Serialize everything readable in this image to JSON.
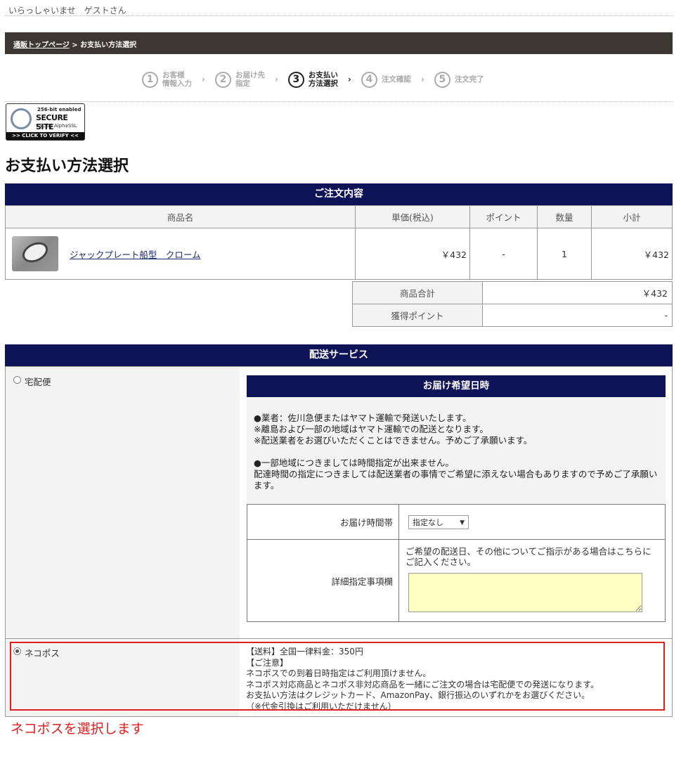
{
  "header": {
    "greeting": "いらっしゃいませ　ゲストさん"
  },
  "breadcrumb": {
    "home": "通販トップページ",
    "sep": " > ",
    "current": "お支払い方法選択"
  },
  "steps": [
    {
      "num": "1",
      "label": "お客様\n情報入力"
    },
    {
      "num": "2",
      "label": "お届け先\n指定"
    },
    {
      "num": "3",
      "label": "お支払い\n方法選択"
    },
    {
      "num": "4",
      "label": "注文確認"
    },
    {
      "num": "5",
      "label": "注文完了"
    }
  ],
  "arrow": "›",
  "ssl": {
    "line1": "256-bit enabled",
    "line2": "SECURE SITE",
    "line3": "SSL by AlphaSSL",
    "verify": ">> CLICK TO VERIFY <<"
  },
  "page_title": "お支払い方法選択",
  "order": {
    "title": "ご注文内容",
    "columns": [
      "商品名",
      "単価(税込)",
      "ポイント",
      "数量",
      "小計"
    ],
    "item": {
      "name": "ジャックプレート船型　クローム",
      "price": "￥432",
      "points": "-",
      "qty": "1",
      "subtotal": "￥432"
    },
    "total_label": "商品合計",
    "total_value": "￥432",
    "points_label": "獲得ポイント",
    "points_value": "-"
  },
  "shipping": {
    "title": "配送サービス",
    "opt1_label": "宅配便",
    "delivery_title": "お届け希望日時",
    "note": [
      "●業者：佐川急便またはヤマト運輸で発送いたします。",
      "※離島および一部の地域はヤマト運輸での配送となります。",
      "※配送業者をお選びいただくことはできません。予めご了承願います。",
      "●一部地域につきましては時間指定が出来ません。",
      "配達時間の指定につきましては配送業者の事情でご希望に添えない場合もありますので予めご了承願います。"
    ],
    "time_label": "お届け時間帯",
    "time_value": "指定なし",
    "detail_label": "詳細指定事項欄",
    "detail_hint": "ご希望の配送日、その他についてご指示がある場合はこちらにご記入ください。",
    "opt2_label": "ネコポス",
    "neko_info": [
      "【送料】全国一律料金：350円",
      "【ご注意】",
      "ネコポスでの到着日時指定はご利用頂けません。",
      "ネコポス対応商品とネコポス非対応商品を一緒にご注文の場合は宅配便での発送になります。",
      "お支払い方法はクレジットカード、AmazonPay、銀行振込のいずれかをお選びください。",
      "（※代金引換はご利用いただけません）"
    ]
  },
  "annotation": "ネコポスを選択します",
  "colors": {
    "navy": "#0e1257",
    "crumbbar": "#3d3733",
    "highlight": "#e02020",
    "textarea": "#ffffc4"
  }
}
